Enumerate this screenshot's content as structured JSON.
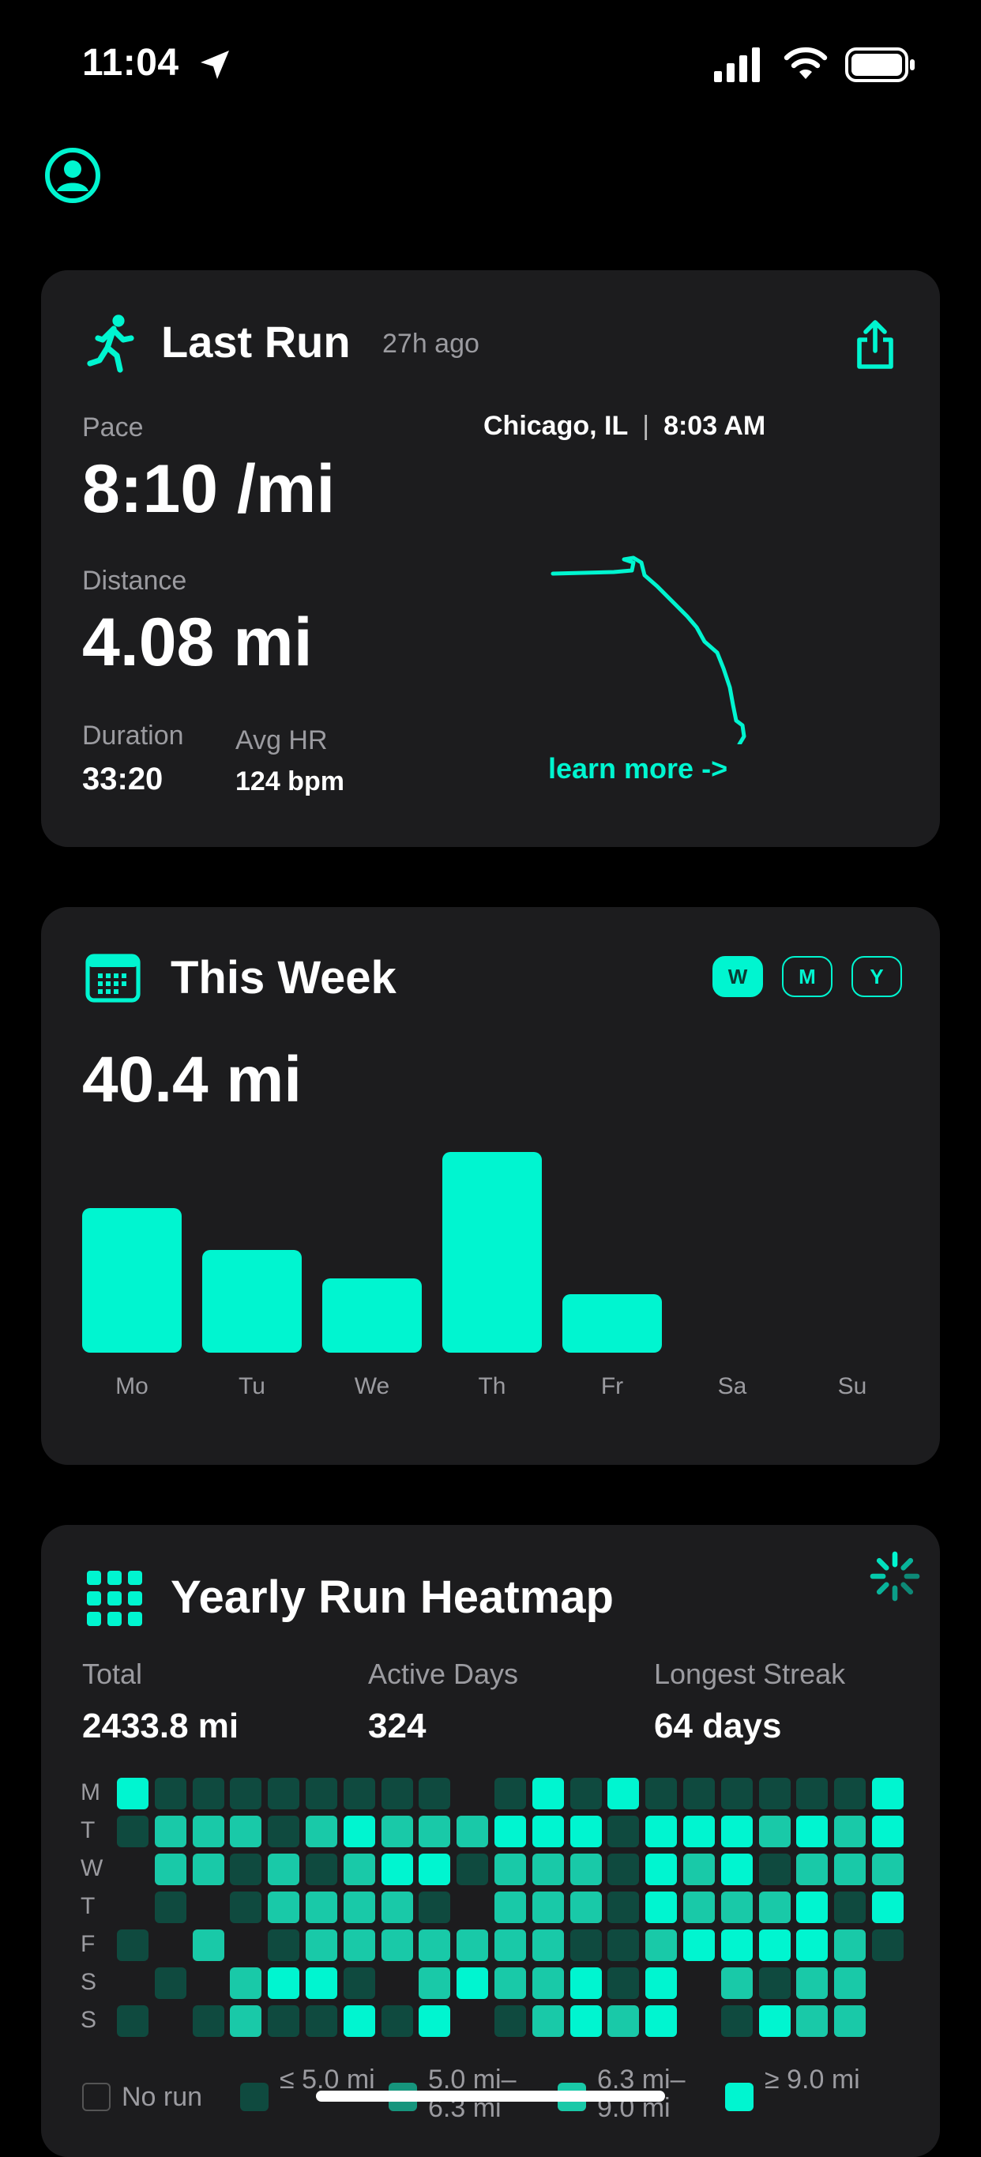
{
  "status_bar": {
    "time": "11:04"
  },
  "last_run": {
    "title": "Last Run",
    "ago": "27h ago",
    "pace_label": "Pace",
    "pace_value": "8:10 /mi",
    "distance_label": "Distance",
    "distance_value": "4.08 mi",
    "duration_label": "Duration",
    "duration_value": "33:20",
    "hr_label": "Avg HR",
    "hr_value": "124 bpm",
    "location": "Chicago, IL",
    "separator": "|",
    "time": "8:03 AM",
    "learn_more": "learn more ->"
  },
  "this_week": {
    "title": "This Week",
    "total": "40.4 mi",
    "toggles": [
      "W",
      "M",
      "Y"
    ],
    "active_toggle": "W",
    "chart_data": {
      "type": "bar",
      "categories": [
        "Mo",
        "Tu",
        "We",
        "Th",
        "Fr",
        "Sa",
        "Su"
      ],
      "values": [
        7.2,
        5.1,
        3.7,
        10.0,
        2.9,
        0,
        0
      ]
    }
  },
  "heatmap": {
    "title": "Yearly Run Heatmap",
    "total_label": "Total",
    "total_value": "2433.8 mi",
    "active_label": "Active Days",
    "active_value": "324",
    "streak_label": "Longest Streak",
    "streak_value": "64 days",
    "day_labels": [
      "M",
      "T",
      "W",
      "T",
      "F",
      "S",
      "S"
    ],
    "grid": [
      [
        4,
        1,
        1,
        1,
        1,
        1,
        1,
        1,
        1,
        0,
        1,
        4,
        1,
        4,
        1,
        1,
        1,
        1,
        1,
        1,
        4
      ],
      [
        1,
        3,
        3,
        3,
        1,
        3,
        4,
        3,
        3,
        3,
        4,
        4,
        4,
        1,
        4,
        4,
        4,
        3,
        4,
        3,
        4
      ],
      [
        0,
        3,
        3,
        1,
        3,
        1,
        3,
        4,
        4,
        1,
        3,
        3,
        3,
        1,
        4,
        3,
        4,
        1,
        3,
        3,
        3
      ],
      [
        0,
        1,
        0,
        1,
        3,
        3,
        3,
        3,
        1,
        0,
        3,
        3,
        3,
        1,
        4,
        3,
        3,
        3,
        4,
        1,
        4
      ],
      [
        1,
        0,
        3,
        0,
        1,
        3,
        3,
        3,
        3,
        3,
        3,
        3,
        1,
        1,
        3,
        4,
        4,
        4,
        4,
        3,
        1
      ],
      [
        0,
        1,
        0,
        3,
        4,
        4,
        1,
        0,
        3,
        4,
        3,
        3,
        4,
        1,
        4,
        0,
        3,
        1,
        3,
        3,
        0
      ],
      [
        1,
        0,
        1,
        3,
        1,
        1,
        4,
        1,
        4,
        0,
        1,
        3,
        4,
        3,
        4,
        0,
        1,
        4,
        3,
        3,
        0
      ]
    ],
    "legend": [
      {
        "label": "No run",
        "level": 0
      },
      {
        "label": "≤ 5.0 mi",
        "level": 1
      },
      {
        "label": "5.0 mi– 6.3 mi",
        "level": 2
      },
      {
        "label": "6.3 mi– 9.0 mi",
        "level": 3
      },
      {
        "label": "≥ 9.0 mi",
        "level": 4
      }
    ]
  },
  "colors": {
    "accent": "#00f5d0",
    "card": "#1c1c1e",
    "background": "#000000"
  }
}
